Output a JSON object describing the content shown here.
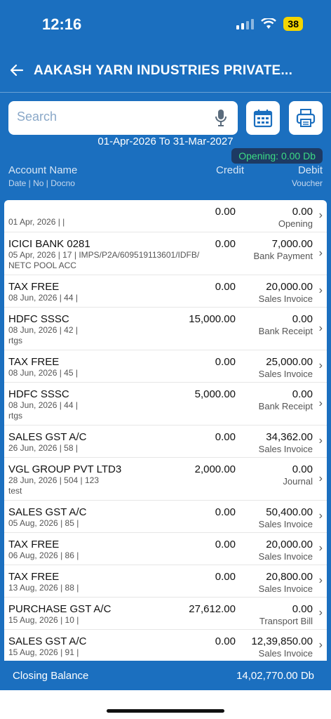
{
  "status": {
    "time": "12:16",
    "battery": "38"
  },
  "header": {
    "title": "AAKASH YARN INDUSTRIES PRIVATE..."
  },
  "search": {
    "placeholder": "Search"
  },
  "date_range": "01-Apr-2026 To 31-Mar-2027",
  "opening_badge": "Opening: 0.00 Db",
  "columns": {
    "account_name": "Account Name",
    "account_sub": "Date | No | Docno",
    "credit": "Credit",
    "debit": "Debit",
    "debit_sub": "Voucher"
  },
  "rows": [
    {
      "account": "",
      "meta": "01 Apr, 2026 |  |",
      "credit": "0.00",
      "debit": "0.00",
      "voucher": "Opening"
    },
    {
      "account": "ICICI BANK 0281",
      "meta": "05 Apr, 2026 | 17 | IMPS/P2A/609519113601/IDFB/\nNETC POOL ACC",
      "credit": "0.00",
      "debit": "7,000.00",
      "voucher": "Bank Payment"
    },
    {
      "account": "TAX FREE",
      "meta": "08 Jun, 2026 | 44 |",
      "credit": "0.00",
      "debit": "20,000.00",
      "voucher": "Sales Invoice"
    },
    {
      "account": "HDFC SSSC",
      "meta": "08 Jun, 2026 | 42 |\nrtgs",
      "credit": "15,000.00",
      "debit": "0.00",
      "voucher": "Bank Receipt"
    },
    {
      "account": "TAX FREE",
      "meta": "08 Jun, 2026 | 45 |",
      "credit": "0.00",
      "debit": "25,000.00",
      "voucher": "Sales Invoice"
    },
    {
      "account": "HDFC SSSC",
      "meta": "08 Jun, 2026 | 44 |\nrtgs",
      "credit": "5,000.00",
      "debit": "0.00",
      "voucher": "Bank Receipt"
    },
    {
      "account": "SALES GST A/C",
      "meta": "26 Jun, 2026 | 58 |",
      "credit": "0.00",
      "debit": "34,362.00",
      "voucher": "Sales Invoice"
    },
    {
      "account": "VGL GROUP PVT LTD3",
      "meta": "28 Jun, 2026 | 504 | 123\ntest",
      "credit": "2,000.00",
      "debit": "0.00",
      "voucher": "Journal"
    },
    {
      "account": "SALES GST A/C",
      "meta": "05 Aug, 2026 | 85 |",
      "credit": "0.00",
      "debit": "50,400.00",
      "voucher": "Sales Invoice"
    },
    {
      "account": "TAX FREE",
      "meta": "06 Aug, 2026 | 86 |",
      "credit": "0.00",
      "debit": "20,000.00",
      "voucher": "Sales Invoice"
    },
    {
      "account": "TAX FREE",
      "meta": "13 Aug, 2026 | 88 |",
      "credit": "0.00",
      "debit": "20,800.00",
      "voucher": "Sales Invoice"
    },
    {
      "account": "PURCHASE GST A/C",
      "meta": "15 Aug, 2026 | 10 |",
      "credit": "27,612.00",
      "debit": "0.00",
      "voucher": "Transport Bill"
    },
    {
      "account": "SALES GST A/C",
      "meta": "15 Aug, 2026 | 91 |",
      "credit": "0.00",
      "debit": "12,39,850.00",
      "voucher": "Sales Invoice"
    }
  ],
  "footer": {
    "label": "Closing Balance",
    "value": "14,02,770.00 Db"
  },
  "colors": {
    "primary": "#1b6fbf",
    "badge_bg": "#1d3a63",
    "badge_text": "#3ddc84"
  }
}
